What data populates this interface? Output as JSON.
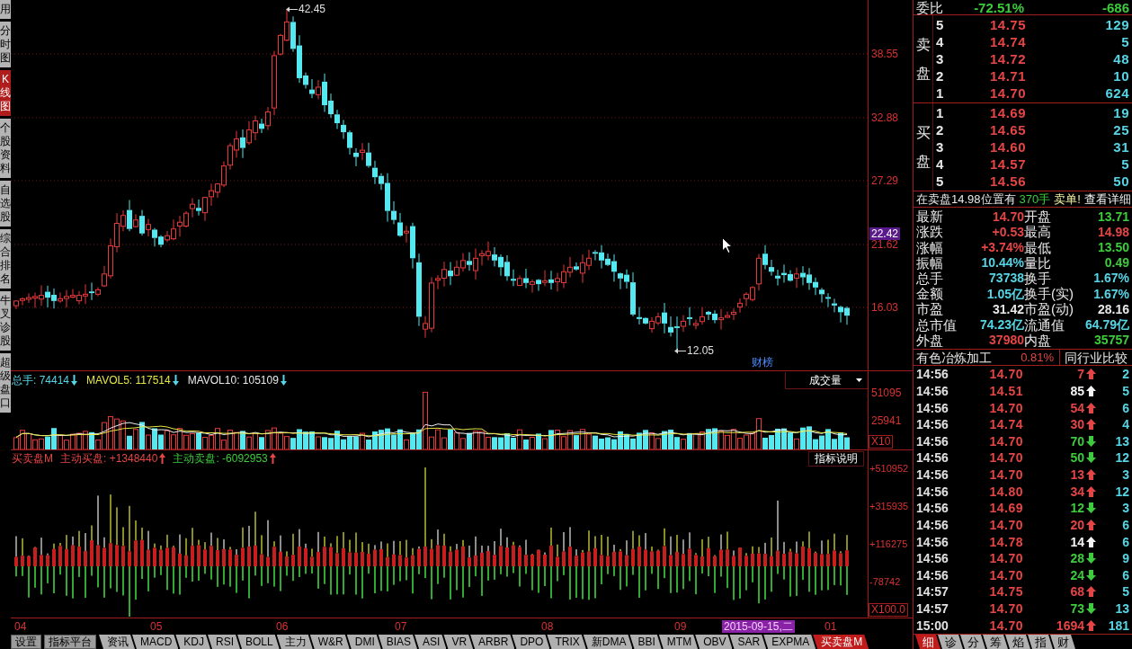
{
  "side_tabs": [
    {
      "label": "用",
      "selected": false
    },
    {
      "label": "分时图",
      "selected": false
    },
    {
      "label": "K线图",
      "selected": true
    },
    {
      "label": "个股资料",
      "selected": false
    },
    {
      "label": "自选股",
      "selected": false
    },
    {
      "label": "综合排名",
      "selected": false
    },
    {
      "label": "牛叉诊股",
      "selected": false
    },
    {
      "label": "超级盘口",
      "selected": false
    }
  ],
  "price_chart": {
    "axis_labels": [
      {
        "text": "38.55",
        "highlighted": false
      },
      {
        "text": "32.88",
        "highlighted": false
      },
      {
        "text": "27.29",
        "highlighted": false
      },
      {
        "text": "22.42",
        "highlighted": true
      },
      {
        "text": "21.62",
        "highlighted": false
      },
      {
        "text": "16.03",
        "highlighted": false
      }
    ],
    "high_label": "42.45",
    "low_label": "12.05",
    "event_tag": "财榜"
  },
  "volume_pane": {
    "legend": [
      {
        "text": "总手: 74414",
        "color": "#55d5e5",
        "up": false
      },
      {
        "text": "MAVOL5: 117514",
        "color": "#e6e646",
        "up": false
      },
      {
        "text": "MAVOL10: 105109",
        "color": "#e8e8e8",
        "up": false
      }
    ],
    "selector": "成交量",
    "axis_labels": [
      "51095",
      "25941"
    ],
    "scale": "X10"
  },
  "indicator_pane": {
    "name": "买卖盘M",
    "legend": [
      {
        "text": "主动买盘: +1348440",
        "color": "#e64545",
        "up": true
      },
      {
        "text": "主动卖盘: -6092953",
        "color": "#3ccc3c",
        "up": true
      }
    ],
    "help_button": "指标说明",
    "axis_labels": [
      "+510952",
      "+315935",
      "+116275",
      "-78742"
    ],
    "scale": "X100.0"
  },
  "date_axis": [
    {
      "text": "04",
      "highlighted": false
    },
    {
      "text": "05",
      "highlighted": false
    },
    {
      "text": "06",
      "highlighted": false
    },
    {
      "text": "07",
      "highlighted": false
    },
    {
      "text": "08",
      "highlighted": false
    },
    {
      "text": "09",
      "highlighted": false
    },
    {
      "text": "2015-09-15,二",
      "highlighted": true
    },
    {
      "text": "01",
      "highlighted": false
    }
  ],
  "bottom_buttons": [
    "设置",
    "指标平台"
  ],
  "bottom_tabs": [
    {
      "label": "资讯",
      "selected": false
    },
    {
      "label": "MACD",
      "selected": false
    },
    {
      "label": "KDJ",
      "selected": false
    },
    {
      "label": "RSI",
      "selected": false
    },
    {
      "label": "BOLL",
      "selected": false
    },
    {
      "label": "主力",
      "selected": false
    },
    {
      "label": "W&R",
      "selected": false
    },
    {
      "label": "DMI",
      "selected": false
    },
    {
      "label": "BIAS",
      "selected": false
    },
    {
      "label": "ASI",
      "selected": false
    },
    {
      "label": "VR",
      "selected": false
    },
    {
      "label": "ARBR",
      "selected": false
    },
    {
      "label": "DPO",
      "selected": false
    },
    {
      "label": "TRIX",
      "selected": false
    },
    {
      "label": "新DMA",
      "selected": false
    },
    {
      "label": "BBI",
      "selected": false
    },
    {
      "label": "MTM",
      "selected": false
    },
    {
      "label": "OBV",
      "selected": false
    },
    {
      "label": "SAR",
      "selected": false
    },
    {
      "label": "EXPMA",
      "selected": false
    },
    {
      "label": "买卖盘M",
      "selected": true
    }
  ],
  "quote_panel": {
    "commission_ratio": {
      "label": "委比",
      "percent": "-72.51%",
      "difference": "-686"
    },
    "sell_orders": {
      "label": "卖盘",
      "levels": [
        {
          "level": "5",
          "price": "14.75",
          "volume": "129"
        },
        {
          "level": "4",
          "price": "14.74",
          "volume": "5"
        },
        {
          "level": "3",
          "price": "14.72",
          "volume": "48"
        },
        {
          "level": "2",
          "price": "14.71",
          "volume": "10"
        },
        {
          "level": "1",
          "price": "14.70",
          "volume": "624"
        }
      ]
    },
    "buy_orders": {
      "label": "买盘",
      "levels": [
        {
          "level": "1",
          "price": "14.69",
          "volume": "19"
        },
        {
          "level": "2",
          "price": "14.65",
          "volume": "25"
        },
        {
          "level": "3",
          "price": "14.60",
          "volume": "31"
        },
        {
          "level": "4",
          "price": "14.57",
          "volume": "5"
        },
        {
          "level": "5",
          "price": "14.56",
          "volume": "50"
        }
      ]
    },
    "notice": [
      {
        "text": "在卖盘14.98位置有",
        "color": "#e8e8e8"
      },
      {
        "text": "370手",
        "color": "#3ccc3c"
      },
      {
        "text": "卖单!",
        "color": "#f0f0a0"
      }
    ],
    "notice_link": "查看详细",
    "stats": [
      {
        "label": "最新",
        "value": "14.70",
        "color": "#e64545"
      },
      {
        "label": "开盘",
        "value": "13.71",
        "color": "#3ccc3c"
      },
      {
        "label": "涨跌",
        "value": "+0.53",
        "color": "#e64545"
      },
      {
        "label": "最高",
        "value": "14.98",
        "color": "#e64545"
      },
      {
        "label": "涨幅",
        "value": "+3.74%",
        "color": "#e64545"
      },
      {
        "label": "最低",
        "value": "13.50",
        "color": "#3ccc3c"
      },
      {
        "label": "振幅",
        "value": "10.44%",
        "color": "#55d5e5"
      },
      {
        "label": "量比",
        "value": "0.49",
        "color": "#3ccc3c"
      },
      {
        "label": "总手",
        "value": "73738",
        "color": "#55d5e5"
      },
      {
        "label": "换手",
        "value": "1.67%",
        "color": "#55d5e5"
      },
      {
        "label": "金额",
        "value": "1.05亿",
        "color": "#55d5e5"
      },
      {
        "label": "换手(实)",
        "value": "1.67%",
        "color": "#55d5e5"
      },
      {
        "label": "市盈",
        "value": "31.42",
        "color": "#e8e8e8"
      },
      {
        "label": "市盈(动)",
        "value": "28.16",
        "color": "#e8e8e8"
      },
      {
        "label": "总市值",
        "value": "74.23亿",
        "color": "#55d5e5"
      },
      {
        "label": "流通值",
        "value": "64.79亿",
        "color": "#55d5e5"
      },
      {
        "label": "外盘",
        "value": "37980",
        "color": "#e64545"
      },
      {
        "label": "内盘",
        "value": "35757",
        "color": "#3ccc3c"
      }
    ],
    "industry": {
      "name": "有色冶炼加工",
      "change": "0.81%",
      "compare_button": "同行业比较"
    },
    "ticks": [
      {
        "time": "14:56",
        "price": "14.70",
        "volume": "7",
        "up": true,
        "color": "#e64545",
        "count": "2"
      },
      {
        "time": "14:56",
        "price": "14.51",
        "volume": "85",
        "up": true,
        "color": "#f4f4f4",
        "count": "5"
      },
      {
        "time": "14:56",
        "price": "14.70",
        "volume": "54",
        "up": true,
        "color": "#e64545",
        "count": "6"
      },
      {
        "time": "14:56",
        "price": "14.74",
        "volume": "30",
        "up": true,
        "color": "#e64545",
        "count": "4"
      },
      {
        "time": "14:56",
        "price": "14.70",
        "volume": "70",
        "up": false,
        "color": "#3ccc3c",
        "count": "13"
      },
      {
        "time": "14:56",
        "price": "14.70",
        "volume": "50",
        "up": false,
        "color": "#3ccc3c",
        "count": "12"
      },
      {
        "time": "14:56",
        "price": "14.70",
        "volume": "13",
        "up": true,
        "color": "#e64545",
        "count": "3"
      },
      {
        "time": "14:56",
        "price": "14.80",
        "volume": "34",
        "up": true,
        "color": "#e64545",
        "count": "12"
      },
      {
        "time": "14:56",
        "price": "14.69",
        "volume": "12",
        "up": false,
        "color": "#3ccc3c",
        "count": "3"
      },
      {
        "time": "14:56",
        "price": "14.70",
        "volume": "20",
        "up": true,
        "color": "#e64545",
        "count": "6"
      },
      {
        "time": "14:56",
        "price": "14.78",
        "volume": "14",
        "up": true,
        "color": "#f4f4f4",
        "count": "6"
      },
      {
        "time": "14:56",
        "price": "14.70",
        "volume": "28",
        "up": false,
        "color": "#3ccc3c",
        "count": "9"
      },
      {
        "time": "14:56",
        "price": "14.70",
        "volume": "24",
        "up": false,
        "color": "#3ccc3c",
        "count": "6"
      },
      {
        "time": "14:57",
        "price": "14.75",
        "volume": "68",
        "up": true,
        "color": "#e64545",
        "count": "5"
      },
      {
        "time": "14:57",
        "price": "14.70",
        "volume": "73",
        "up": false,
        "color": "#3ccc3c",
        "count": "13"
      },
      {
        "time": "15:00",
        "price": "14.70",
        "volume": "1694",
        "up": true,
        "color": "#e64545",
        "count": "181"
      }
    ],
    "tabs": [
      {
        "label": "细",
        "selected": true
      },
      {
        "label": "诊",
        "selected": false
      },
      {
        "label": "分",
        "selected": false
      },
      {
        "label": "筹",
        "selected": false
      },
      {
        "label": "焰",
        "selected": false
      },
      {
        "label": "指",
        "selected": false
      },
      {
        "label": "财",
        "selected": false
      }
    ]
  }
}
